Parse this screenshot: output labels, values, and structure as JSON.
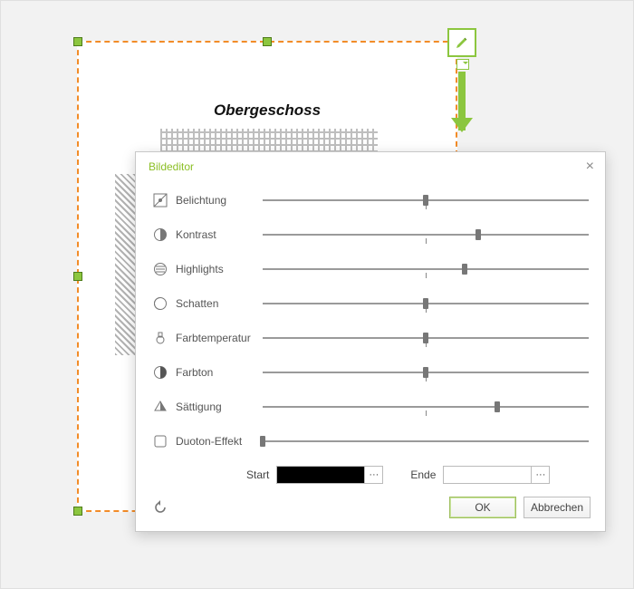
{
  "background": {
    "title": "Obergeschoss"
  },
  "toolbar": {
    "edit_tooltip": "Bild bearbeiten"
  },
  "dialog": {
    "title": "Bildeditor",
    "sliders": [
      {
        "label": "Belichtung",
        "value": 50,
        "center_tick": 50
      },
      {
        "label": "Kontrast",
        "value": 66,
        "center_tick": 50
      },
      {
        "label": "Highlights",
        "value": 62,
        "center_tick": 50
      },
      {
        "label": "Schatten",
        "value": 50,
        "center_tick": 50
      },
      {
        "label": "Farbtemperatur",
        "value": 50,
        "center_tick": 50
      },
      {
        "label": "Farbton",
        "value": 50,
        "center_tick": 50
      },
      {
        "label": "Sättigung",
        "value": 72,
        "center_tick": 50
      },
      {
        "label": "Duoton-Effekt",
        "value": 0,
        "center_tick": null
      }
    ],
    "duotone": {
      "start_label": "Start",
      "start_color": "#000000",
      "end_label": "Ende",
      "end_color": "#ffffff"
    },
    "reset_tooltip": "Zurücksetzen",
    "buttons": {
      "ok": "OK",
      "cancel": "Abbrechen"
    }
  }
}
